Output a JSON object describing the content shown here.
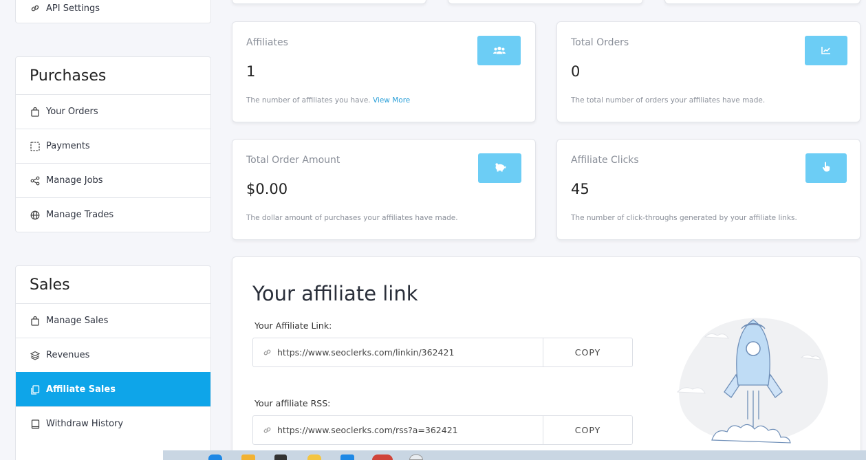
{
  "sidebar": {
    "api_settings": "API Settings",
    "purchases": {
      "title": "Purchases",
      "items": [
        {
          "label": "Your Orders",
          "icon": "bag-icon"
        },
        {
          "label": "Payments",
          "icon": "dashed-square-icon"
        },
        {
          "label": "Manage Jobs",
          "icon": "share-icon"
        },
        {
          "label": "Manage Trades",
          "icon": "globe-icon"
        }
      ]
    },
    "sales": {
      "title": "Sales",
      "items": [
        {
          "label": "Manage Sales",
          "icon": "bag-icon"
        },
        {
          "label": "Revenues",
          "icon": "layers-icon"
        },
        {
          "label": "Affiliate Sales",
          "icon": "copy-icon",
          "active": true
        },
        {
          "label": "Withdraw History",
          "icon": "book-icon"
        }
      ]
    }
  },
  "stats": {
    "affiliates": {
      "label": "Affiliates",
      "value": "1",
      "desc": "The number of affiliates you have.",
      "link": "View More",
      "icon": "users-icon"
    },
    "total_orders": {
      "label": "Total Orders",
      "value": "0",
      "desc": "The total number of orders your affiliates have made.",
      "icon": "chart-icon"
    },
    "total_order_amount": {
      "label": "Total Order Amount",
      "value": "$0.00",
      "desc": "The dollar amount of purchases your affiliates have made.",
      "icon": "piggy-bank-icon"
    },
    "affiliate_clicks": {
      "label": "Affiliate Clicks",
      "value": "45",
      "desc": "The number of click-throughs generated by your affiliate links.",
      "icon": "hand-pointer-icon"
    }
  },
  "affiliate": {
    "heading": "Your affiliate link",
    "link_label": "Your Affiliate Link:",
    "link_value": "https://www.seoclerks.com/linkin/362421",
    "rss_label": "Your affiliate RSS:",
    "rss_value": "https://www.seoclerks.com/rss?a=362421",
    "copy_label": "COPY"
  },
  "colors": {
    "accent": "#0ea5e9",
    "icon_button": "#6ccdf5",
    "link": "#2a9fd8"
  }
}
